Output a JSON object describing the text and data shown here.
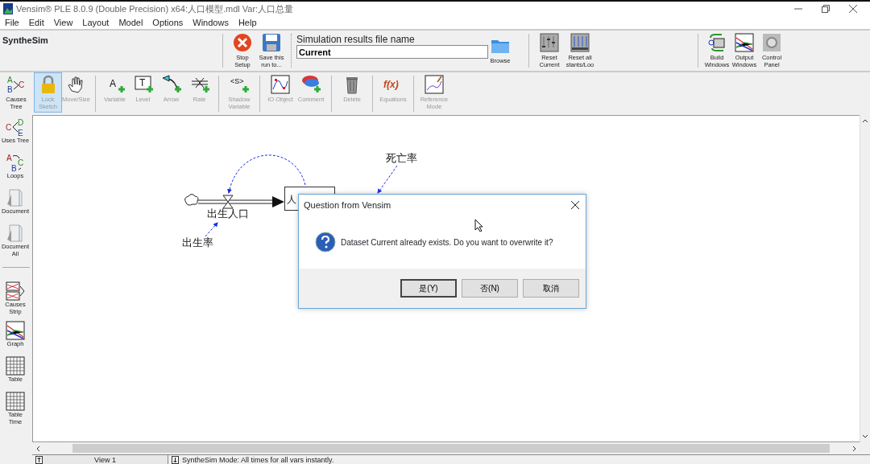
{
  "window": {
    "title": "Vensim® PLE 8.0.9 (Double Precision) x64:人口模型.mdl Var:人口总量"
  },
  "menu": [
    "File",
    "Edit",
    "View",
    "Layout",
    "Model",
    "Options",
    "Windows",
    "Help"
  ],
  "synthesim": {
    "title": "SyntheSim"
  },
  "run_buttons": [
    {
      "label": "Stop Setup",
      "kind": "stop"
    },
    {
      "label": "Save this run to...",
      "kind": "save"
    }
  ],
  "results_file": {
    "label": "Simulation results file name",
    "value": "Current",
    "browse": "Browse"
  },
  "reset_buttons": [
    {
      "label": "Reset Current",
      "kind": "reset-one"
    },
    {
      "label": "Reset all stants/Loo",
      "kind": "reset-all"
    }
  ],
  "window_buttons": [
    {
      "label": "Build Windows",
      "kind": "build"
    },
    {
      "label": "Output Windows",
      "kind": "output"
    },
    {
      "label": "Control Panel",
      "kind": "control"
    }
  ],
  "sketch_groups": [
    {
      "tools": [
        {
          "label": "Causes Tree",
          "kind": "causes-tree",
          "glyph": "A B C",
          "selected": false,
          "disabled": false
        },
        {
          "label": "Lock Sketch",
          "kind": "lock",
          "selected": true,
          "disabled": true
        },
        {
          "label": "Move/Size",
          "kind": "move",
          "selected": false,
          "disabled": true
        }
      ]
    },
    {
      "tools": [
        {
          "label": "Variable",
          "kind": "variable",
          "glyph": "A",
          "selected": false,
          "disabled": true
        },
        {
          "label": "Level",
          "kind": "level",
          "glyph": "T",
          "selected": false,
          "disabled": true
        },
        {
          "label": "Arrow",
          "kind": "arrow",
          "selected": false,
          "disabled": true
        },
        {
          "label": "Rate",
          "kind": "rate",
          "selected": false,
          "disabled": true
        }
      ]
    },
    {
      "tools": [
        {
          "label": "Shadow Variable",
          "kind": "shadow",
          "glyph": "<S>",
          "selected": false,
          "disabled": true
        }
      ]
    },
    {
      "tools": [
        {
          "label": "IO Object",
          "kind": "io",
          "selected": false,
          "disabled": true
        },
        {
          "label": "Comment",
          "kind": "comment",
          "selected": false,
          "disabled": true
        }
      ]
    },
    {
      "tools": [
        {
          "label": "Delete",
          "kind": "delete",
          "selected": false,
          "disabled": true
        }
      ]
    },
    {
      "tools": [
        {
          "label": "Equations",
          "kind": "equations",
          "glyph": "f(x)",
          "selected": false,
          "disabled": true
        }
      ]
    },
    {
      "tools": [
        {
          "label": "Reference Mode",
          "kind": "refmode",
          "selected": false,
          "disabled": true
        }
      ]
    }
  ],
  "analysis_groups": [
    {
      "tools": [
        {
          "label": "Uses Tree",
          "kind": "uses-tree",
          "glyph": "C D E"
        },
        {
          "label": "Loops",
          "kind": "loops",
          "glyph": "A C B"
        },
        {
          "label": "Document",
          "kind": "document"
        },
        {
          "label": "Document All",
          "kind": "document"
        }
      ]
    },
    {
      "tools": [
        {
          "label": "Causes Strip",
          "kind": "strip"
        },
        {
          "label": "Graph",
          "kind": "graph"
        },
        {
          "label": "Table",
          "kind": "table"
        },
        {
          "label": "Table Time",
          "kind": "table"
        }
      ]
    }
  ],
  "diagram": {
    "stock": "人",
    "flow": "出生人口",
    "variables": [
      "出生率",
      "死亡率"
    ]
  },
  "dialog": {
    "title": "Question from Vensim",
    "message": "Dataset Current already exists.  Do you want to overwrite it?",
    "buttons": [
      {
        "label": "是(Y)",
        "default": true
      },
      {
        "label": "否(N)",
        "default": false
      },
      {
        "label": "取消",
        "default": false
      }
    ]
  },
  "status_bar": {
    "view": "View 1",
    "message": "SyntheSim Mode: All times for all vars instantly."
  }
}
